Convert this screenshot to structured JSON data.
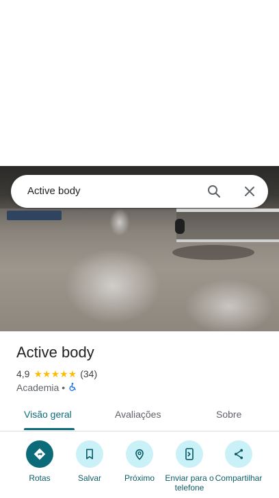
{
  "search": {
    "query": "Active body"
  },
  "place": {
    "name": "Active body",
    "rating": "4,9",
    "stars": "★★★★★",
    "review_count": "(34)",
    "category": "Academia",
    "separator": "•"
  },
  "tabs": [
    {
      "label": "Visão geral",
      "active": true
    },
    {
      "label": "Avaliações",
      "active": false
    },
    {
      "label": "Sobre",
      "active": false
    }
  ],
  "actions": [
    {
      "label": "Rotas",
      "icon": "directions-icon"
    },
    {
      "label": "Salvar",
      "icon": "bookmark-icon"
    },
    {
      "label": "Próximo",
      "icon": "nearby-icon"
    },
    {
      "label": "Enviar para o telefone",
      "icon": "send-to-phone-icon"
    },
    {
      "label": "Compartilhar",
      "icon": "share-icon"
    }
  ],
  "colors": {
    "accent": "#0b6b78",
    "action_bg": "#c9f1f7",
    "stars": "#fbbc04",
    "accessible_icon": "#1a73e8"
  }
}
